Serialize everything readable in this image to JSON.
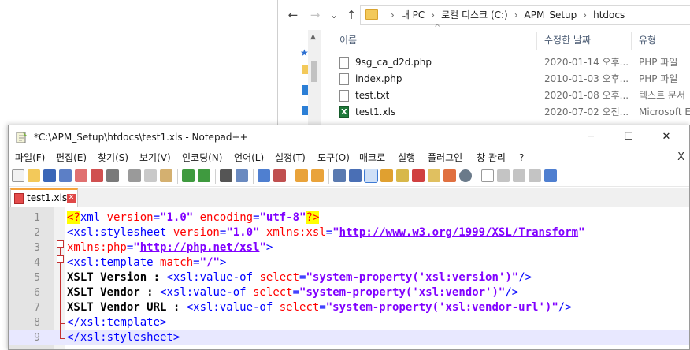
{
  "explorer": {
    "nav": {
      "back": "←",
      "forward": "→",
      "dropdown": "⌄",
      "up": "↑"
    },
    "breadcrumb": [
      "내 PC",
      "로컬 디스크 (C:)",
      "APM_Setup",
      "htdocs"
    ],
    "columns": {
      "name": "이름",
      "modified": "수정한 날짜",
      "type": "유형"
    },
    "files": [
      {
        "name": "9sg_ca_d2d.php",
        "modified": "2020-01-14 오후...",
        "type": "PHP 파일",
        "icon": "php-file-icon"
      },
      {
        "name": "index.php",
        "modified": "2010-01-03 오후...",
        "type": "PHP 파일",
        "icon": "php-file-icon"
      },
      {
        "name": "test.txt",
        "modified": "2020-01-08 오후...",
        "type": "텍스트 문서",
        "icon": "text-file-icon"
      },
      {
        "name": "test1.xls",
        "modified": "2020-07-02 오전...",
        "type": "Microsoft Ex",
        "icon": "excel-file-icon"
      }
    ]
  },
  "notepad": {
    "title": "*C:\\APM_Setup\\htdocs\\test1.xls - Notepad++",
    "window_buttons": {
      "minimize": "─",
      "maximize": "☐",
      "close": "✕"
    },
    "menu": [
      "파일(F)",
      "편집(E)",
      "찾기(S)",
      "보기(V)",
      "인코딩(N)",
      "언어(L)",
      "설정(T)",
      "도구(O)",
      "매크로",
      "실행",
      "플러그인",
      "창 관리",
      "?"
    ],
    "menu_close": "X",
    "tab": {
      "label": "test1.xls",
      "close": "✕"
    },
    "lines": [
      {
        "num": "1",
        "tokens": [
          {
            "t": "<?",
            "c": "t-pi"
          },
          {
            "t": "xml ",
            "c": "t-tag"
          },
          {
            "t": "version",
            "c": "t-attr"
          },
          {
            "t": "=",
            "c": "t-tag"
          },
          {
            "t": "\"1.0\"",
            "c": "t-val"
          },
          {
            "t": " ",
            "c": "t-tag"
          },
          {
            "t": "encoding",
            "c": "t-attr"
          },
          {
            "t": "=",
            "c": "t-tag"
          },
          {
            "t": "\"utf-8\"",
            "c": "t-val"
          },
          {
            "t": "?>",
            "c": "t-pi"
          }
        ]
      },
      {
        "num": "2",
        "tokens": [
          {
            "t": "<xsl:stylesheet ",
            "c": "t-tag"
          },
          {
            "t": "version",
            "c": "t-attr"
          },
          {
            "t": "=",
            "c": "t-tag"
          },
          {
            "t": "\"1.0\"",
            "c": "t-val"
          },
          {
            "t": " ",
            "c": "t-tag"
          },
          {
            "t": "xmlns:xsl",
            "c": "t-attr"
          },
          {
            "t": "=",
            "c": "t-tag"
          },
          {
            "t": "\"",
            "c": "t-val"
          },
          {
            "t": "http://www.w3.org/1999/XSL/Transform",
            "c": "t-url"
          },
          {
            "t": "\"",
            "c": "t-val"
          }
        ]
      },
      {
        "num": "3",
        "tokens": [
          {
            "t": "xmlns:php",
            "c": "t-attr"
          },
          {
            "t": "=",
            "c": "t-tag"
          },
          {
            "t": "\"",
            "c": "t-val"
          },
          {
            "t": "http://php.net/xsl",
            "c": "t-url"
          },
          {
            "t": "\"",
            "c": "t-val"
          },
          {
            "t": ">",
            "c": "t-tag"
          }
        ]
      },
      {
        "num": "4",
        "tokens": [
          {
            "t": "<xsl:template ",
            "c": "t-tag"
          },
          {
            "t": "match",
            "c": "t-attr"
          },
          {
            "t": "=",
            "c": "t-tag"
          },
          {
            "t": "\"/\"",
            "c": "t-val"
          },
          {
            "t": ">",
            "c": "t-tag"
          }
        ]
      },
      {
        "num": "5",
        "tokens": [
          {
            "t": "XSLT Version : ",
            "c": "t-txt"
          },
          {
            "t": "<xsl:value-of ",
            "c": "t-tag"
          },
          {
            "t": "select",
            "c": "t-attr"
          },
          {
            "t": "=",
            "c": "t-tag"
          },
          {
            "t": "\"system-property('xsl:version')\"",
            "c": "t-val"
          },
          {
            "t": "/>",
            "c": "t-tag"
          }
        ]
      },
      {
        "num": "6",
        "tokens": [
          {
            "t": "XSLT Vendor : ",
            "c": "t-txt"
          },
          {
            "t": "<xsl:value-of ",
            "c": "t-tag"
          },
          {
            "t": "select",
            "c": "t-attr"
          },
          {
            "t": "=",
            "c": "t-tag"
          },
          {
            "t": "\"system-property('xsl:vendor')\"",
            "c": "t-val"
          },
          {
            "t": "/>",
            "c": "t-tag"
          }
        ]
      },
      {
        "num": "7",
        "tokens": [
          {
            "t": "XSLT Vendor URL : ",
            "c": "t-txt"
          },
          {
            "t": "<xsl:value-of ",
            "c": "t-tag"
          },
          {
            "t": "select",
            "c": "t-attr"
          },
          {
            "t": "=",
            "c": "t-tag"
          },
          {
            "t": "\"system-property('xsl:vendor-url')\"",
            "c": "t-val"
          },
          {
            "t": "/>",
            "c": "t-tag"
          }
        ]
      },
      {
        "num": "8",
        "tokens": [
          {
            "t": "</xsl:template>",
            "c": "t-tag"
          }
        ]
      },
      {
        "num": "9",
        "tokens": [
          {
            "t": "</xsl:stylesheet>",
            "c": "t-tag"
          }
        ]
      }
    ]
  },
  "colors": {
    "tag": "#0000ff",
    "attribute": "#ff0000",
    "value": "#8000ff",
    "current_line": "#e8e8ff",
    "tab_accent": "#f5a33b"
  }
}
